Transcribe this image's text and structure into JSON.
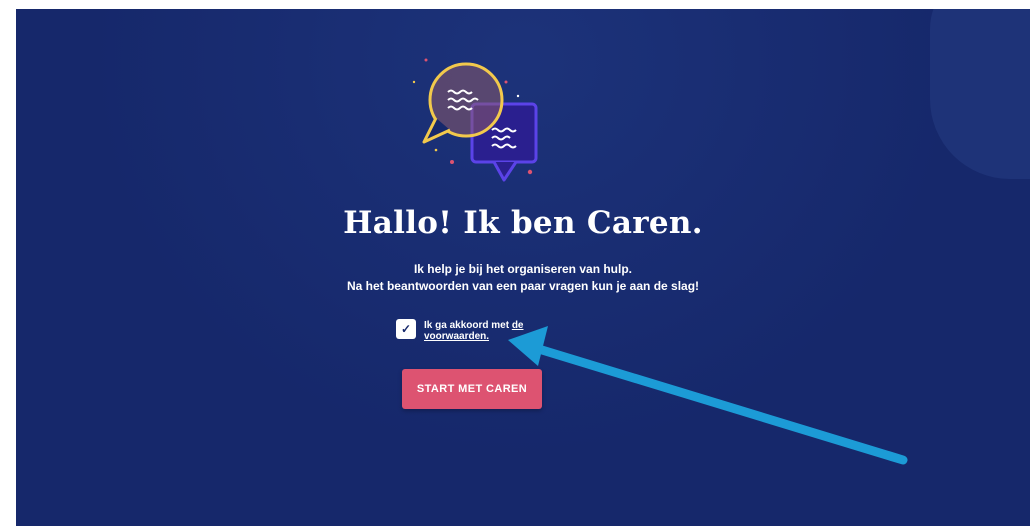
{
  "hero": {
    "title": "Hallo! Ik ben Caren.",
    "subtitle_line1": "Ik help je bij het organiseren van hulp.",
    "subtitle_line2": "Na het beantwoorden van een paar vragen kun je aan de slag!"
  },
  "consent": {
    "checked": true,
    "checkmark": "✓",
    "text_prefix": "Ik ga akkoord met ",
    "link_text": "de voorwaarden."
  },
  "start_button": {
    "label": "START MET CAREN"
  },
  "colors": {
    "background": "#16286b",
    "button": "#dd5371",
    "arrow": "#1c9bd6",
    "bubble_yellow": "#f2c94c",
    "bubble_purple": "#4b3ad6"
  },
  "icons": {
    "illustration": "chat-bubbles-icon",
    "annotation": "blue-arrow-icon"
  }
}
